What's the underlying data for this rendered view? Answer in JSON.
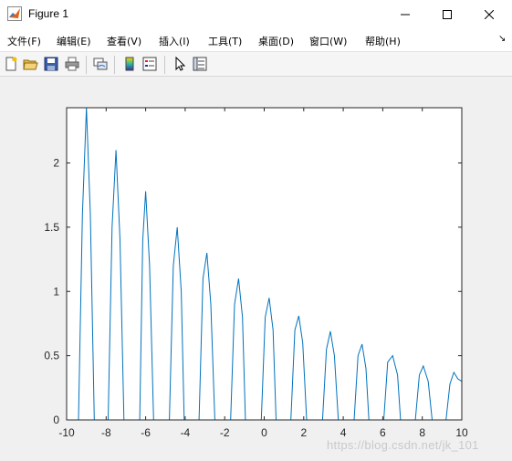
{
  "window": {
    "title": "Figure 1",
    "controls": {
      "minimize": "minimize",
      "maximize": "maximize",
      "close": "close"
    }
  },
  "menubar": {
    "items": [
      {
        "label": "文件(F)"
      },
      {
        "label": "编辑(E)"
      },
      {
        "label": "查看(V)"
      },
      {
        "label": "插入(I)"
      },
      {
        "label": "工具(T)"
      },
      {
        "label": "桌面(D)"
      },
      {
        "label": "窗口(W)"
      },
      {
        "label": "帮助(H)"
      }
    ],
    "overflow_icon": "dock-arrow-icon"
  },
  "toolbar": {
    "buttons": [
      {
        "icon": "new-figure-icon"
      },
      {
        "icon": "open-file-icon"
      },
      {
        "icon": "save-icon"
      },
      {
        "icon": "print-icon"
      },
      {
        "icon": "link-plot-icon"
      },
      {
        "icon": "insert-colorbar-icon"
      },
      {
        "icon": "insert-legend-icon"
      },
      {
        "icon": "edit-plot-arrow-icon"
      },
      {
        "icon": "property-inspector-icon"
      }
    ]
  },
  "watermark": "https://blog.csdn.net/jk_101",
  "chart_data": {
    "type": "line",
    "title": "",
    "xlabel": "",
    "ylabel": "",
    "xlim": [
      -10,
      10
    ],
    "ylim": [
      0,
      2.43
    ],
    "x_ticks": [
      "-10",
      "-8",
      "-6",
      "-4",
      "-2",
      "0",
      "2",
      "4",
      "6",
      "8",
      "10"
    ],
    "y_ticks": [
      "0",
      "0.5",
      "1",
      "1.5",
      "2"
    ],
    "line_color": "#0072bd",
    "grid": false,
    "series": [
      {
        "x": [
          -10,
          -9.4,
          -9.2,
          -9.0,
          -8.8,
          -8.6,
          -7.9,
          -7.7,
          -7.5,
          -7.3,
          -7.1,
          -6.3,
          -6.15,
          -6.0,
          -5.8,
          -5.6,
          -4.8,
          -4.6,
          -4.4,
          -4.2,
          -4.05,
          -3.3,
          -3.1,
          -2.9,
          -2.7,
          -2.5,
          -1.7,
          -1.5,
          -1.3,
          -1.1,
          -0.95,
          -0.15,
          0.05,
          0.25,
          0.45,
          0.6,
          1.35,
          1.55,
          1.75,
          1.95,
          2.15,
          2.95,
          3.15,
          3.35,
          3.55,
          3.75,
          4.55,
          4.75,
          4.95,
          5.15,
          5.3,
          6.05,
          6.25,
          6.5,
          6.75,
          6.9,
          7.65,
          7.85,
          8.05,
          8.3,
          8.5,
          9.2,
          9.4,
          9.6,
          9.8,
          10
        ],
        "y": [
          0,
          0,
          1.6,
          2.43,
          1.6,
          0,
          0,
          1.5,
          2.1,
          1.4,
          0,
          0,
          1.4,
          1.78,
          1.2,
          0,
          0,
          1.2,
          1.5,
          1.0,
          0,
          0,
          1.1,
          1.3,
          0.9,
          0,
          0,
          0.9,
          1.1,
          0.8,
          0,
          0,
          0.8,
          0.95,
          0.7,
          0,
          0,
          0.7,
          0.81,
          0.6,
          0,
          0,
          0.55,
          0.69,
          0.5,
          0,
          0,
          0.5,
          0.59,
          0.4,
          0,
          0,
          0.45,
          0.5,
          0.35,
          0,
          0,
          0.35,
          0.42,
          0.3,
          0,
          0,
          0.28,
          0.37,
          0.32,
          0.3
        ]
      }
    ]
  }
}
